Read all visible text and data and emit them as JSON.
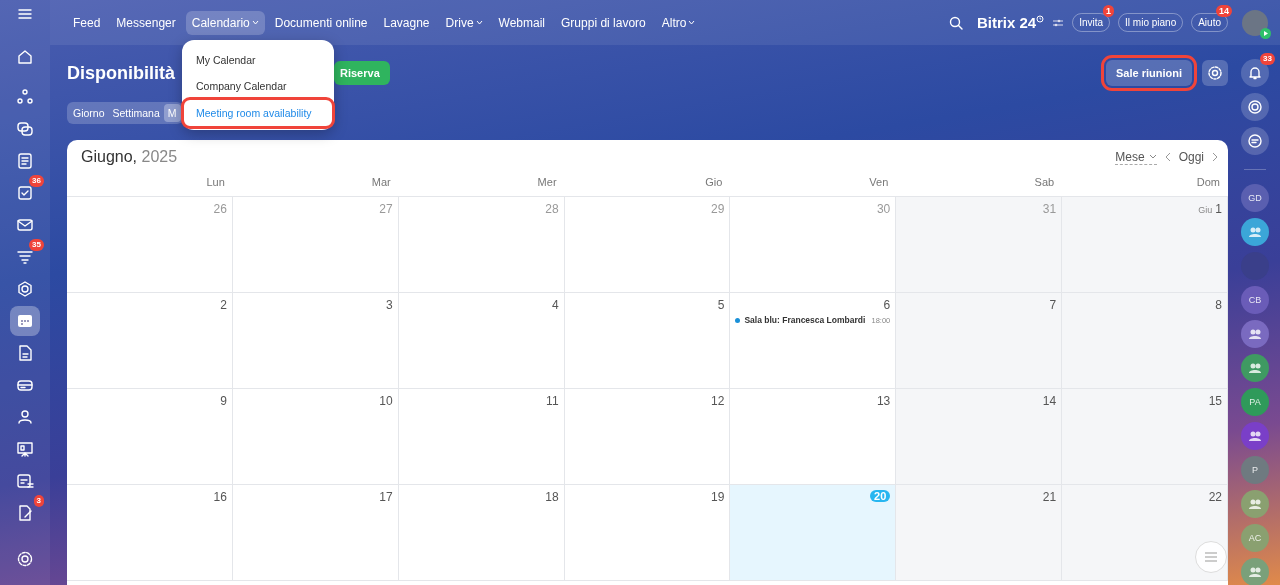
{
  "top_nav": {
    "items": [
      {
        "label": "Feed",
        "selected": false,
        "dropdown": false
      },
      {
        "label": "Messenger",
        "selected": false,
        "dropdown": false
      },
      {
        "label": "Calendario",
        "selected": true,
        "dropdown": true
      },
      {
        "label": "Documenti online",
        "selected": false,
        "dropdown": false
      },
      {
        "label": "Lavagne",
        "selected": false,
        "dropdown": false
      },
      {
        "label": "Drive",
        "selected": false,
        "dropdown": true
      },
      {
        "label": "Webmail",
        "selected": false,
        "dropdown": false
      },
      {
        "label": "Gruppi di lavoro",
        "selected": false,
        "dropdown": false
      },
      {
        "label": "Altro",
        "selected": false,
        "dropdown": true
      }
    ],
    "brand": "Bitrix 24",
    "buttons": [
      {
        "label": "Invita",
        "badge": "1"
      },
      {
        "label": "Il mio piano"
      },
      {
        "label": "Aiuto",
        "badge": "14"
      }
    ]
  },
  "dropdown_menu": {
    "items": [
      {
        "label": "My Calendar",
        "selected": false,
        "highlighted": false
      },
      {
        "label": "Company Calendar",
        "selected": false,
        "highlighted": false
      },
      {
        "label": "Meeting room availability",
        "selected": true,
        "highlighted": true
      }
    ]
  },
  "left_sidebar": {
    "items": [
      {
        "selected": false
      },
      {
        "selected": false
      },
      {
        "selected": false
      },
      {
        "selected": false
      },
      {
        "selected": false,
        "badge": "36"
      },
      {
        "selected": false
      },
      {
        "selected": false,
        "badge": "35"
      },
      {
        "selected": false
      },
      {
        "selected": true
      },
      {
        "selected": false
      },
      {
        "selected": false
      },
      {
        "selected": false
      },
      {
        "selected": false
      },
      {
        "selected": false
      },
      {
        "selected": false,
        "badge": "3"
      }
    ]
  },
  "page": {
    "title": "Disponibilità",
    "add_button": "Riserva",
    "rooms_button": {
      "label": "Sale riunioni",
      "highlighted": true
    },
    "view_tabs": [
      {
        "label": "Giorno",
        "selected": false
      },
      {
        "label": "Settimana",
        "selected": false
      },
      {
        "label": "M",
        "selected": true
      }
    ]
  },
  "calendar": {
    "month": "Giugno,",
    "year": "2025",
    "view_select": "Mese",
    "today_button": "Oggi",
    "weekdays": [
      "Lun",
      "Mar",
      "Mer",
      "Gio",
      "Ven",
      "Sab",
      "Dom"
    ],
    "weeks": [
      [
        {
          "day": "26",
          "other_month": true
        },
        {
          "day": "27",
          "other_month": true
        },
        {
          "day": "28",
          "other_month": true
        },
        {
          "day": "29",
          "other_month": true
        },
        {
          "day": "30",
          "other_month": true
        },
        {
          "day": "31",
          "other_month": true
        },
        {
          "day": "1",
          "month_label": "Giu",
          "other_month": false
        }
      ],
      [
        {
          "day": "2",
          "other_month": false
        },
        {
          "day": "3",
          "other_month": false
        },
        {
          "day": "4",
          "other_month": false
        },
        {
          "day": "5",
          "other_month": false
        },
        {
          "day": "6",
          "other_month": false,
          "events": [
            {
              "title": "Sala blu: Francesca Lombardi",
              "time": "18:00",
              "color": "#1a90d8"
            }
          ]
        },
        {
          "day": "7",
          "other_month": false
        },
        {
          "day": "8",
          "other_month": false
        }
      ],
      [
        {
          "day": "9",
          "other_month": false
        },
        {
          "day": "10",
          "other_month": false
        },
        {
          "day": "11",
          "other_month": false
        },
        {
          "day": "12",
          "other_month": false
        },
        {
          "day": "13",
          "other_month": false
        },
        {
          "day": "14",
          "other_month": false
        },
        {
          "day": "15",
          "other_month": false
        }
      ],
      [
        {
          "day": "16",
          "other_month": false
        },
        {
          "day": "17",
          "other_month": false
        },
        {
          "day": "18",
          "other_month": false
        },
        {
          "day": "19",
          "other_month": false
        },
        {
          "day": "20",
          "other_month": false,
          "today": true
        },
        {
          "day": "21",
          "other_month": false
        },
        {
          "day": "22",
          "other_month": false
        }
      ]
    ]
  },
  "right_sidebar": {
    "items": [
      {
        "kind": "icon",
        "badge": "33"
      },
      {
        "kind": "icon"
      },
      {
        "kind": "icon"
      },
      {
        "kind": "avatar",
        "initials": "GD",
        "color": "#5a5fb0"
      },
      {
        "kind": "icon",
        "color": "#3ba6d8"
      },
      {
        "kind": "picture",
        "color": "#3a3f8a"
      },
      {
        "kind": "avatar",
        "initials": "CB",
        "color": "#6a5cb8"
      },
      {
        "kind": "icon",
        "color": "#7a6ac0"
      },
      {
        "kind": "icon",
        "color": "#3f9a62"
      },
      {
        "kind": "avatar",
        "initials": "PA",
        "color": "#2f9a5a"
      },
      {
        "kind": "icon",
        "color": "#7a3fc8"
      },
      {
        "kind": "avatar",
        "initials": "P",
        "color": "#6f7a80"
      },
      {
        "kind": "icon",
        "color": "#8aa070"
      },
      {
        "kind": "avatar",
        "initials": "AC",
        "color": "#8aa070"
      },
      {
        "kind": "icon",
        "color": "#7aa07a"
      }
    ]
  }
}
